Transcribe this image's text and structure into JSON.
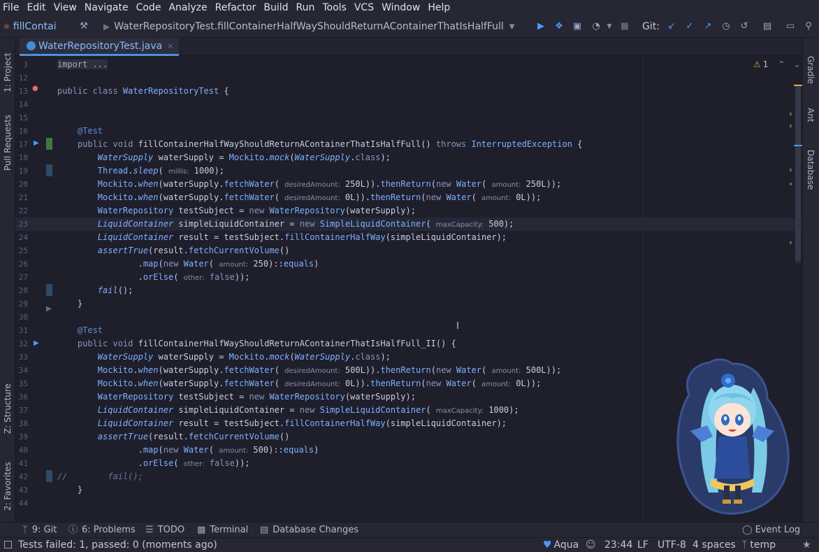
{
  "menu": [
    "File",
    "Edit",
    "View",
    "Navigate",
    "Code",
    "Analyze",
    "Refactor",
    "Build",
    "Run",
    "Tools",
    "VCS",
    "Window",
    "Help"
  ],
  "toolbar": {
    "run_config": "fillContai",
    "test_select": "WaterRepositoryTest.fillContainerHalfWayShouldReturnAContainerThatIsHalfFull",
    "git_label": "Git:"
  },
  "editor_tab": {
    "label": "WaterRepositoryTest.java",
    "close": "×"
  },
  "left_tools": [
    {
      "label": "1: Project"
    },
    {
      "label": "Pull Requests"
    },
    {
      "label": "Z: Structure"
    },
    {
      "label": "2: Favorites"
    }
  ],
  "right_tools": [
    {
      "label": "Gradle"
    },
    {
      "label": "Ant"
    },
    {
      "label": "Database"
    }
  ],
  "inspection": {
    "warnings": "1"
  },
  "code": [
    {
      "n": "3",
      "t": [
        [
          "fold",
          "import ..."
        ]
      ]
    },
    {
      "n": "12",
      "t": []
    },
    {
      "n": "13",
      "t": [
        [
          "kw",
          "public class "
        ],
        [
          "type",
          "WaterRepositoryTest"
        ],
        [
          "p",
          " {"
        ]
      ]
    },
    {
      "n": "14",
      "t": []
    },
    {
      "n": "15",
      "t": []
    },
    {
      "n": "16",
      "t": [
        [
          "p",
          "    "
        ],
        [
          "ann",
          "@Test"
        ]
      ]
    },
    {
      "n": "17",
      "t": [
        [
          "p",
          "    "
        ],
        [
          "kw",
          "public void "
        ],
        [
          "p",
          "fillContainerHalfWayShouldReturnAContainerThatIsHalfFull() "
        ],
        [
          "kw",
          "throws "
        ],
        [
          "type",
          "InterruptedException"
        ],
        [
          "p",
          " {"
        ]
      ]
    },
    {
      "n": "18",
      "t": [
        [
          "p",
          "        "
        ],
        [
          "itype",
          "WaterSupply"
        ],
        [
          "p",
          " waterSupply = "
        ],
        [
          "type",
          "Mockito"
        ],
        [
          "p",
          "."
        ],
        [
          "icall",
          "mock"
        ],
        [
          "p",
          "("
        ],
        [
          "itype",
          "WaterSupply"
        ],
        [
          "p",
          "."
        ],
        [
          "kw",
          "class"
        ],
        [
          "p",
          ");"
        ]
      ]
    },
    {
      "n": "19",
      "t": [
        [
          "p",
          "        "
        ],
        [
          "type",
          "Thread"
        ],
        [
          "p",
          "."
        ],
        [
          "icall",
          "sleep"
        ],
        [
          "p",
          "( "
        ],
        [
          "hint",
          "millis:"
        ],
        [
          "p",
          " 1000);"
        ]
      ]
    },
    {
      "n": "20",
      "t": [
        [
          "p",
          "        "
        ],
        [
          "type",
          "Mockito"
        ],
        [
          "p",
          "."
        ],
        [
          "icall",
          "when"
        ],
        [
          "p",
          "(waterSupply."
        ],
        [
          "call",
          "fetchWater"
        ],
        [
          "p",
          "( "
        ],
        [
          "hint",
          "desiredAmount:"
        ],
        [
          "p",
          " 250L))."
        ],
        [
          "call",
          "thenReturn"
        ],
        [
          "p",
          "("
        ],
        [
          "kw",
          "new "
        ],
        [
          "type",
          "Water"
        ],
        [
          "p",
          "( "
        ],
        [
          "hint",
          "amount:"
        ],
        [
          "p",
          " 250L));"
        ]
      ]
    },
    {
      "n": "21",
      "t": [
        [
          "p",
          "        "
        ],
        [
          "type",
          "Mockito"
        ],
        [
          "p",
          "."
        ],
        [
          "icall",
          "when"
        ],
        [
          "p",
          "(waterSupply."
        ],
        [
          "call",
          "fetchWater"
        ],
        [
          "p",
          "( "
        ],
        [
          "hint",
          "desiredAmount:"
        ],
        [
          "p",
          " 0L))."
        ],
        [
          "call",
          "thenReturn"
        ],
        [
          "p",
          "("
        ],
        [
          "kw",
          "new "
        ],
        [
          "type",
          "Water"
        ],
        [
          "p",
          "( "
        ],
        [
          "hint",
          "amount:"
        ],
        [
          "p",
          " 0L));"
        ]
      ]
    },
    {
      "n": "22",
      "t": [
        [
          "p",
          "        "
        ],
        [
          "type",
          "WaterRepository"
        ],
        [
          "p",
          " testSubject = "
        ],
        [
          "kw",
          "new "
        ],
        [
          "type",
          "WaterRepository"
        ],
        [
          "p",
          "(waterSupply);"
        ]
      ]
    },
    {
      "n": "23",
      "cur": true,
      "t": [
        [
          "p",
          "        "
        ],
        [
          "itype",
          "LiquidContainer"
        ],
        [
          "p",
          " simpleLiquidContainer = "
        ],
        [
          "kw",
          "new "
        ],
        [
          "type",
          "SimpleLiquidContainer"
        ],
        [
          "p",
          "( "
        ],
        [
          "hint",
          "maxCapacity:"
        ],
        [
          "p",
          " 500);"
        ]
      ]
    },
    {
      "n": "24",
      "t": [
        [
          "p",
          "        "
        ],
        [
          "itype",
          "LiquidContainer"
        ],
        [
          "p",
          " result = testSubject."
        ],
        [
          "call",
          "fillContainerHalfWay"
        ],
        [
          "p",
          "(simpleLiquidContainer);"
        ]
      ]
    },
    {
      "n": "25",
      "t": [
        [
          "p",
          "        "
        ],
        [
          "icall",
          "assertTrue"
        ],
        [
          "p",
          "(result."
        ],
        [
          "call",
          "fetchCurrentVolume"
        ],
        [
          "p",
          "()"
        ]
      ]
    },
    {
      "n": "26",
      "t": [
        [
          "p",
          "                ."
        ],
        [
          "call",
          "map"
        ],
        [
          "p",
          "("
        ],
        [
          "kw",
          "new "
        ],
        [
          "type",
          "Water"
        ],
        [
          "p",
          "( "
        ],
        [
          "hint",
          "amount:"
        ],
        [
          "p",
          " 250)::"
        ],
        [
          "call",
          "equals"
        ],
        [
          "p",
          ")"
        ]
      ]
    },
    {
      "n": "27",
      "t": [
        [
          "p",
          "                ."
        ],
        [
          "call",
          "orElse"
        ],
        [
          "p",
          "( "
        ],
        [
          "hint",
          "other:"
        ],
        [
          "p",
          " "
        ],
        [
          "kw",
          "false"
        ],
        [
          "p",
          "));"
        ]
      ]
    },
    {
      "n": "28",
      "t": [
        [
          "p",
          "        "
        ],
        [
          "icall",
          "fail"
        ],
        [
          "p",
          "();"
        ]
      ]
    },
    {
      "n": "29",
      "t": [
        [
          "p",
          "    }"
        ]
      ]
    },
    {
      "n": "30",
      "t": []
    },
    {
      "n": "31",
      "t": [
        [
          "p",
          "    "
        ],
        [
          "ann",
          "@Test"
        ]
      ]
    },
    {
      "n": "32",
      "t": [
        [
          "p",
          "    "
        ],
        [
          "kw",
          "public void "
        ],
        [
          "p",
          "fillContainerHalfWayShouldReturnAContainerThatIsHalfFull_II() {"
        ]
      ]
    },
    {
      "n": "33",
      "t": [
        [
          "p",
          "        "
        ],
        [
          "itype",
          "WaterSupply"
        ],
        [
          "p",
          " waterSupply = "
        ],
        [
          "type",
          "Mockito"
        ],
        [
          "p",
          "."
        ],
        [
          "icall",
          "mock"
        ],
        [
          "p",
          "("
        ],
        [
          "itype",
          "WaterSupply"
        ],
        [
          "p",
          "."
        ],
        [
          "kw",
          "class"
        ],
        [
          "p",
          ");"
        ]
      ]
    },
    {
      "n": "34",
      "t": [
        [
          "p",
          "        "
        ],
        [
          "type",
          "Mockito"
        ],
        [
          "p",
          "."
        ],
        [
          "icall",
          "when"
        ],
        [
          "p",
          "(waterSupply."
        ],
        [
          "call",
          "fetchWater"
        ],
        [
          "p",
          "( "
        ],
        [
          "hint",
          "desiredAmount:"
        ],
        [
          "p",
          " 500L))."
        ],
        [
          "call",
          "thenReturn"
        ],
        [
          "p",
          "("
        ],
        [
          "kw",
          "new "
        ],
        [
          "type",
          "Water"
        ],
        [
          "p",
          "( "
        ],
        [
          "hint",
          "amount:"
        ],
        [
          "p",
          " 500L));"
        ]
      ]
    },
    {
      "n": "35",
      "t": [
        [
          "p",
          "        "
        ],
        [
          "type",
          "Mockito"
        ],
        [
          "p",
          "."
        ],
        [
          "icall",
          "when"
        ],
        [
          "p",
          "(waterSupply."
        ],
        [
          "call",
          "fetchWater"
        ],
        [
          "p",
          "( "
        ],
        [
          "hint",
          "desiredAmount:"
        ],
        [
          "p",
          " 0L))."
        ],
        [
          "call",
          "thenReturn"
        ],
        [
          "p",
          "("
        ],
        [
          "kw",
          "new "
        ],
        [
          "type",
          "Water"
        ],
        [
          "p",
          "( "
        ],
        [
          "hint",
          "amount:"
        ],
        [
          "p",
          " 0L));"
        ]
      ]
    },
    {
      "n": "36",
      "t": [
        [
          "p",
          "        "
        ],
        [
          "type",
          "WaterRepository"
        ],
        [
          "p",
          " testSubject = "
        ],
        [
          "kw",
          "new "
        ],
        [
          "type",
          "WaterRepository"
        ],
        [
          "p",
          "(waterSupply);"
        ]
      ]
    },
    {
      "n": "37",
      "t": [
        [
          "p",
          "        "
        ],
        [
          "itype",
          "LiquidContainer"
        ],
        [
          "p",
          " simpleLiquidContainer = "
        ],
        [
          "kw",
          "new "
        ],
        [
          "type",
          "SimpleLiquidContainer"
        ],
        [
          "p",
          "( "
        ],
        [
          "hint",
          "maxCapacity:"
        ],
        [
          "p",
          " 1000);"
        ]
      ]
    },
    {
      "n": "38",
      "t": [
        [
          "p",
          "        "
        ],
        [
          "itype",
          "LiquidContainer"
        ],
        [
          "p",
          " result = testSubject."
        ],
        [
          "call",
          "fillContainerHalfWay"
        ],
        [
          "p",
          "(simpleLiquidContainer);"
        ]
      ]
    },
    {
      "n": "39",
      "t": [
        [
          "p",
          "        "
        ],
        [
          "icall",
          "assertTrue"
        ],
        [
          "p",
          "(result."
        ],
        [
          "call",
          "fetchCurrentVolume"
        ],
        [
          "p",
          "()"
        ]
      ]
    },
    {
      "n": "40",
      "t": [
        [
          "p",
          "                ."
        ],
        [
          "call",
          "map"
        ],
        [
          "p",
          "("
        ],
        [
          "kw",
          "new "
        ],
        [
          "type",
          "Water"
        ],
        [
          "p",
          "( "
        ],
        [
          "hint",
          "amount:"
        ],
        [
          "p",
          " 500)::"
        ],
        [
          "call",
          "equals"
        ],
        [
          "p",
          ")"
        ]
      ]
    },
    {
      "n": "41",
      "t": [
        [
          "p",
          "                ."
        ],
        [
          "call",
          "orElse"
        ],
        [
          "p",
          "( "
        ],
        [
          "hint",
          "other:"
        ],
        [
          "p",
          " "
        ],
        [
          "kw",
          "false"
        ],
        [
          "p",
          "));"
        ]
      ]
    },
    {
      "n": "42",
      "t": [
        [
          "cm",
          "//"
        ],
        [
          "p",
          "        "
        ],
        [
          "cm",
          "fail();"
        ]
      ]
    },
    {
      "n": "43",
      "t": [
        [
          "p",
          "    }"
        ]
      ]
    },
    {
      "n": "44",
      "t": []
    }
  ],
  "bottom_tabs": [
    {
      "label": "9: Git",
      "icon": "git-branch-icon"
    },
    {
      "label": "6: Problems",
      "icon": "problems-icon"
    },
    {
      "label": "TODO",
      "icon": "list-icon"
    },
    {
      "label": "Terminal",
      "icon": "terminal-icon"
    },
    {
      "label": "Database Changes",
      "icon": "database-icon"
    }
  ],
  "event_log": "Event Log",
  "status": {
    "tests": "Tests failed: 1, passed: 0 (moments ago)",
    "theme": "Aqua",
    "position": "23:44",
    "line_sep": "LF",
    "encoding": "UTF-8",
    "indent": "4 spaces",
    "branch": "temp"
  }
}
